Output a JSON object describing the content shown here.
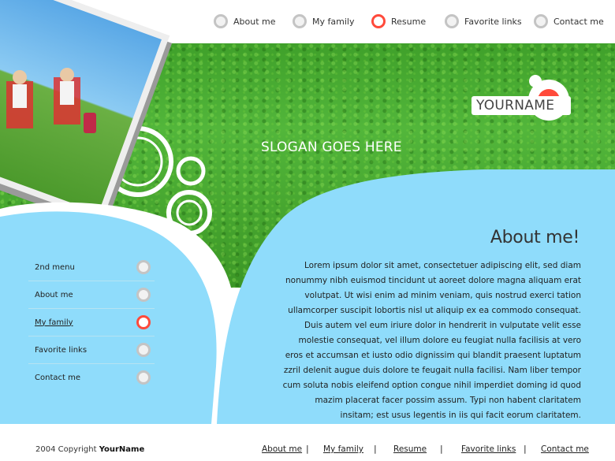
{
  "topnav": {
    "items": [
      {
        "label": "About me",
        "active": false
      },
      {
        "label": "My family",
        "active": false
      },
      {
        "label": "Resume",
        "active": true
      },
      {
        "label": "Favorite links",
        "active": false
      },
      {
        "label": "Contact me",
        "active": false
      }
    ]
  },
  "hero": {
    "slogan": "SLOGAN GOES HERE",
    "yourname": "YOURNAME"
  },
  "content": {
    "title": "About me!",
    "body": "Lorem ipsum dolor sit amet, consectetuer adipiscing elit, sed diam nonummy nibh euismod tincidunt ut aoreet dolore magna aliquam erat volutpat. Ut wisi enim ad minim veniam, quis nostrud exerci tation ullamcorper suscipit lobortis nisl ut aliquip ex ea commodo consequat. Duis autem vel eum iriure dolor in hendrerit in vulputate velit esse molestie consequat, vel illum dolore eu feugiat nulla facilisis at vero eros et accumsan et iusto odio dignissim qui blandit praesent luptatum zzril delenit augue duis dolore te feugait nulla facilisi. Nam liber tempor cum soluta nobis eleifend option congue nihil imperdiet doming id quod mazim placerat facer possim assum. Typi non habent claritatem insitam; est usus legentis in iis qui facit eorum claritatem."
  },
  "sidemenu": {
    "items": [
      {
        "label": "2nd menu",
        "active": false
      },
      {
        "label": "About me",
        "active": false
      },
      {
        "label": "My family",
        "active": true
      },
      {
        "label": "Favorite links",
        "active": false
      },
      {
        "label": "Contact me",
        "active": false
      }
    ]
  },
  "footer": {
    "copyright_prefix": "2004 Copyright",
    "copyright_name": "YourName",
    "links": [
      "About me",
      "My family",
      "Resume",
      "Favorite links",
      "Contact me"
    ],
    "separator": "|"
  },
  "colors": {
    "accent_red": "#ff4a3b",
    "sky_blue": "#8fdcfb",
    "grass_green": "#4aab33"
  }
}
